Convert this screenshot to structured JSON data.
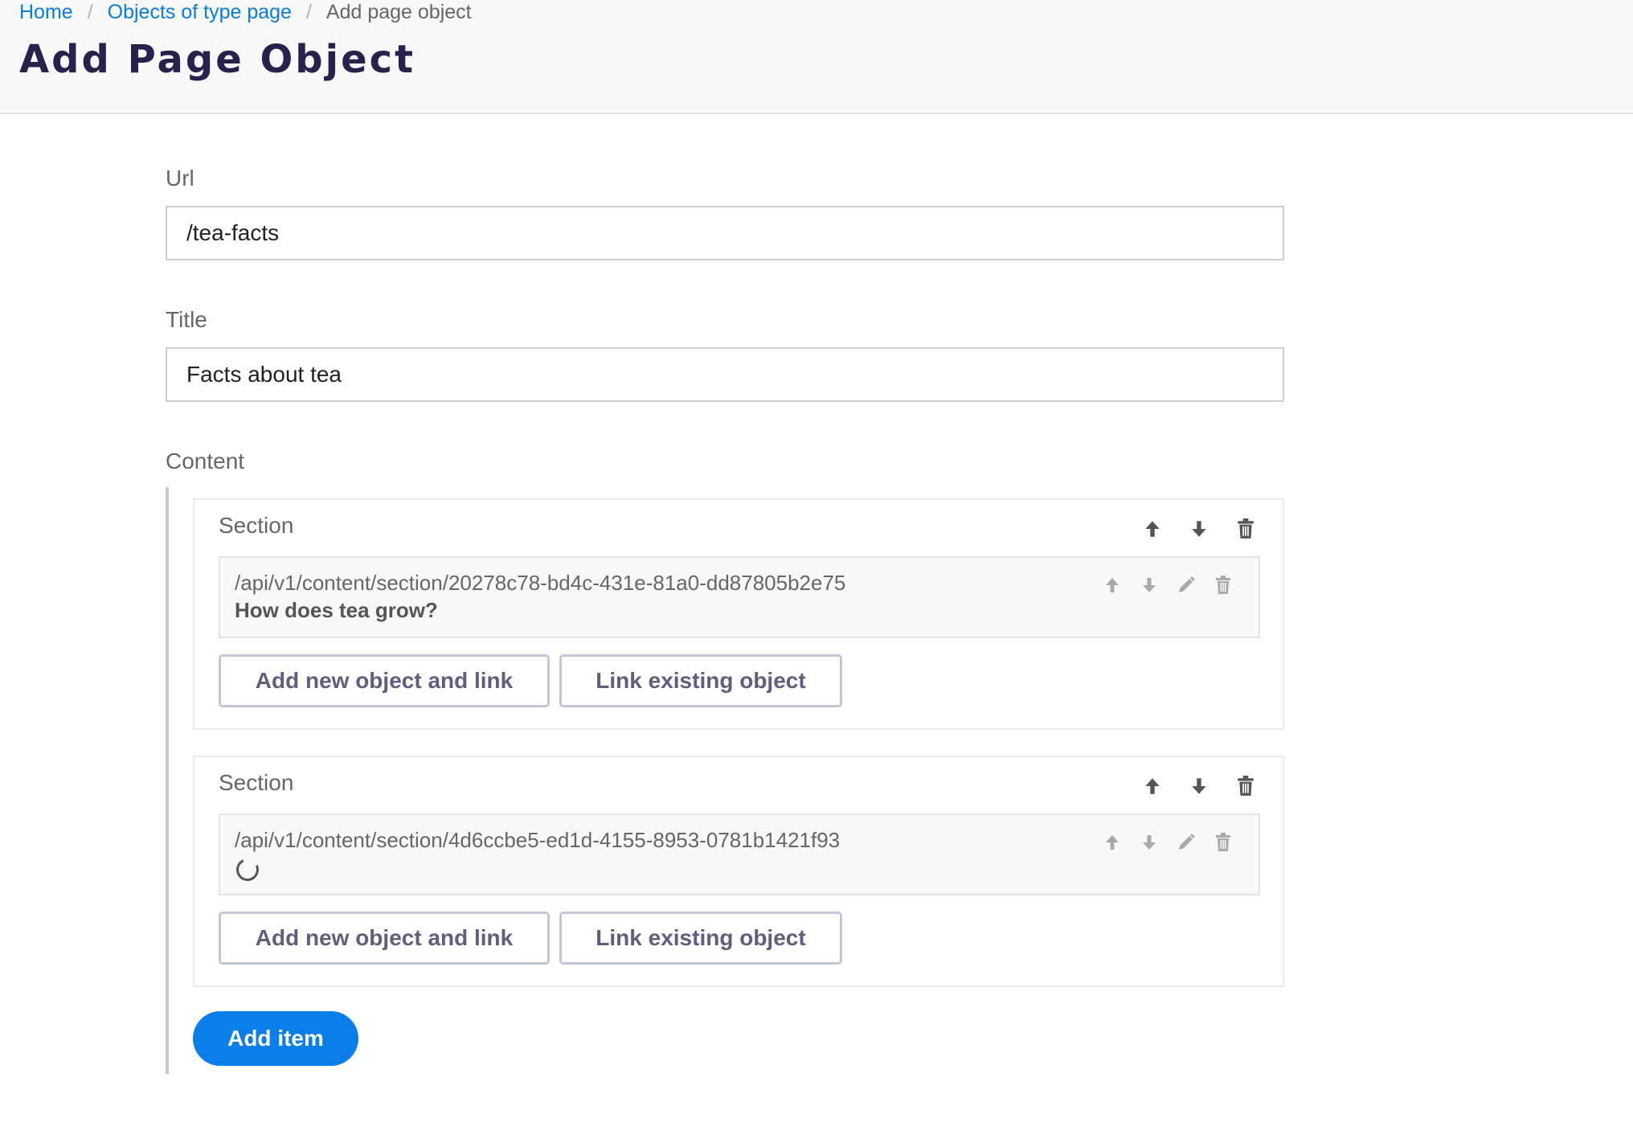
{
  "breadcrumb": {
    "home": "Home",
    "objects": "Objects of type page",
    "current": "Add page object",
    "separator": "/"
  },
  "page_title": "Add Page Object",
  "form": {
    "url": {
      "label": "Url",
      "value": "/tea-facts"
    },
    "title": {
      "label": "Title",
      "value": "Facts about tea"
    },
    "content": {
      "label": "Content",
      "sections": [
        {
          "label": "Section",
          "ref_path": "/api/v1/content/section/20278c78-bd4c-431e-81a0-dd87805b2e75",
          "ref_title": "How does tea grow?",
          "loading": false,
          "add_new_label": "Add new object and link",
          "link_existing_label": "Link existing object"
        },
        {
          "label": "Section",
          "ref_path": "/api/v1/content/section/4d6ccbe5-ed1d-4155-8953-0781b1421f93",
          "ref_title": "",
          "loading": true,
          "add_new_label": "Add new object and link",
          "link_existing_label": "Link existing object"
        }
      ],
      "add_item_label": "Add item"
    }
  },
  "icons": {
    "section_actions": [
      "arrow-up-icon",
      "arrow-down-icon",
      "trash-icon"
    ],
    "ref_actions": [
      "arrow-up-icon",
      "arrow-down-icon",
      "pencil-icon",
      "trash-icon"
    ]
  },
  "colors": {
    "link": "#0a7ee0",
    "title": "#25234b",
    "primary_button": "#0a7ee8",
    "outline_button_border": "#c2c6d6",
    "outline_button_text": "#5e5f7d"
  }
}
